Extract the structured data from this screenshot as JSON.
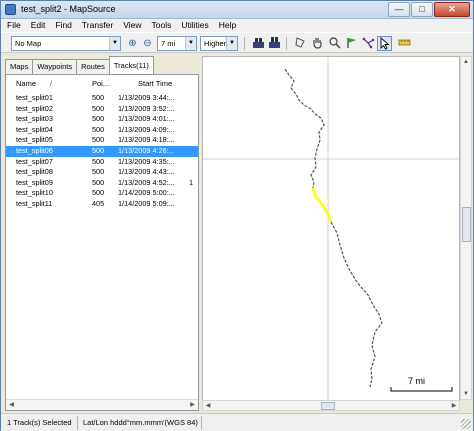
{
  "window": {
    "title": "test_split2 - MapSource",
    "minimize": "—",
    "maximize": "□",
    "close": "✕"
  },
  "menu": [
    "File",
    "Edit",
    "Find",
    "Transfer",
    "View",
    "Tools",
    "Utilities",
    "Help"
  ],
  "toolbar": {
    "map_select": "No Map",
    "zoom_in": "⊕",
    "zoom_out": "⊖",
    "zoom_level": "7 mi",
    "detail": "Higher",
    "icons": [
      "receive-from-device-icon",
      "send-to-device-icon",
      "selection-tool-icon",
      "hand-pan-icon",
      "zoom-tool-icon",
      "waypoint-flag-icon",
      "route-tool-icon",
      "pointer-tool-icon",
      "measure-distance-icon"
    ]
  },
  "tabs": [
    {
      "label": "Maps",
      "active": false
    },
    {
      "label": "Waypoints",
      "active": false
    },
    {
      "label": "Routes",
      "active": false
    },
    {
      "label": "Tracks(11)",
      "active": true
    }
  ],
  "list": {
    "columns": {
      "name": "Name",
      "sort_glyph": "/",
      "points": "Poi...",
      "start_time": "Start Time"
    },
    "rows": [
      {
        "name": "test_split01",
        "points": "500",
        "start_time": "1/13/2009 3:44:...",
        "extra": ""
      },
      {
        "name": "test_split02",
        "points": "500",
        "start_time": "1/13/2009 3:52:...",
        "extra": ""
      },
      {
        "name": "test_split03",
        "points": "500",
        "start_time": "1/13/2009 4:01:...",
        "extra": ""
      },
      {
        "name": "test_split04",
        "points": "500",
        "start_time": "1/13/2009 4:09:...",
        "extra": ""
      },
      {
        "name": "test_split05",
        "points": "500",
        "start_time": "1/13/2009 4:18:...",
        "extra": ""
      },
      {
        "name": "test_split06",
        "points": "500",
        "start_time": "1/13/2009 4:26:...",
        "extra": ""
      },
      {
        "name": "test_split07",
        "points": "500",
        "start_time": "1/13/2009 4:35:...",
        "extra": ""
      },
      {
        "name": "test_split08",
        "points": "500",
        "start_time": "1/13/2009 4:43:...",
        "extra": ""
      },
      {
        "name": "test_split09",
        "points": "500",
        "start_time": "1/13/2009 4:52:...",
        "extra": "1"
      },
      {
        "name": "test_split10",
        "points": "500",
        "start_time": "1/14/2009 5:00:...",
        "extra": ""
      },
      {
        "name": "test_split11",
        "points": "405",
        "start_time": "1/14/2009 5:09:...",
        "extra": ""
      }
    ],
    "selected_index": 5
  },
  "map": {
    "scale_label": "7 mi",
    "track_color": "#555555",
    "highlight_color": "#ffff00",
    "crosshair_color": "#c8c8c8"
  },
  "status": {
    "selection": "1 Track(s) Selected",
    "coordinate_format": "Lat/Lon hddd°mm.mmm'(WGS 84)"
  }
}
